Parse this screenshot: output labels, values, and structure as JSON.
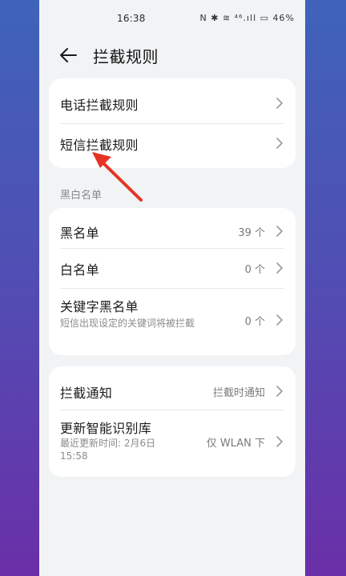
{
  "status_bar": {
    "time": "16:38",
    "icons_text": "N ✱ ≋ ⁴⁶.ıll ▭ 46%"
  },
  "header": {
    "title": "拦截规则"
  },
  "rules_card": {
    "items": [
      {
        "label": "电话拦截规则"
      },
      {
        "label": "短信拦截规则"
      }
    ]
  },
  "list_section": {
    "title": "黑白名单",
    "items": [
      {
        "label": "黑名单",
        "value": "39 个"
      },
      {
        "label": "白名单",
        "value": "0 个"
      },
      {
        "label": "关键字黑名单",
        "subtitle": "短信出现设定的关键词将被拦截",
        "value": "0 个"
      }
    ]
  },
  "settings_card": {
    "items": [
      {
        "label": "拦截通知",
        "value": "拦截时通知"
      },
      {
        "label": "更新智能识别库",
        "subtitle": "最近更新时间: 2月6日 15:58",
        "value": "仅 WLAN 下"
      }
    ]
  },
  "colors": {
    "annotation_arrow": "#e53424",
    "card": "#ffffff",
    "page_bg": "#f1f3f5"
  },
  "icons": [
    "back-arrow-icon",
    "chevron-right-icon"
  ]
}
